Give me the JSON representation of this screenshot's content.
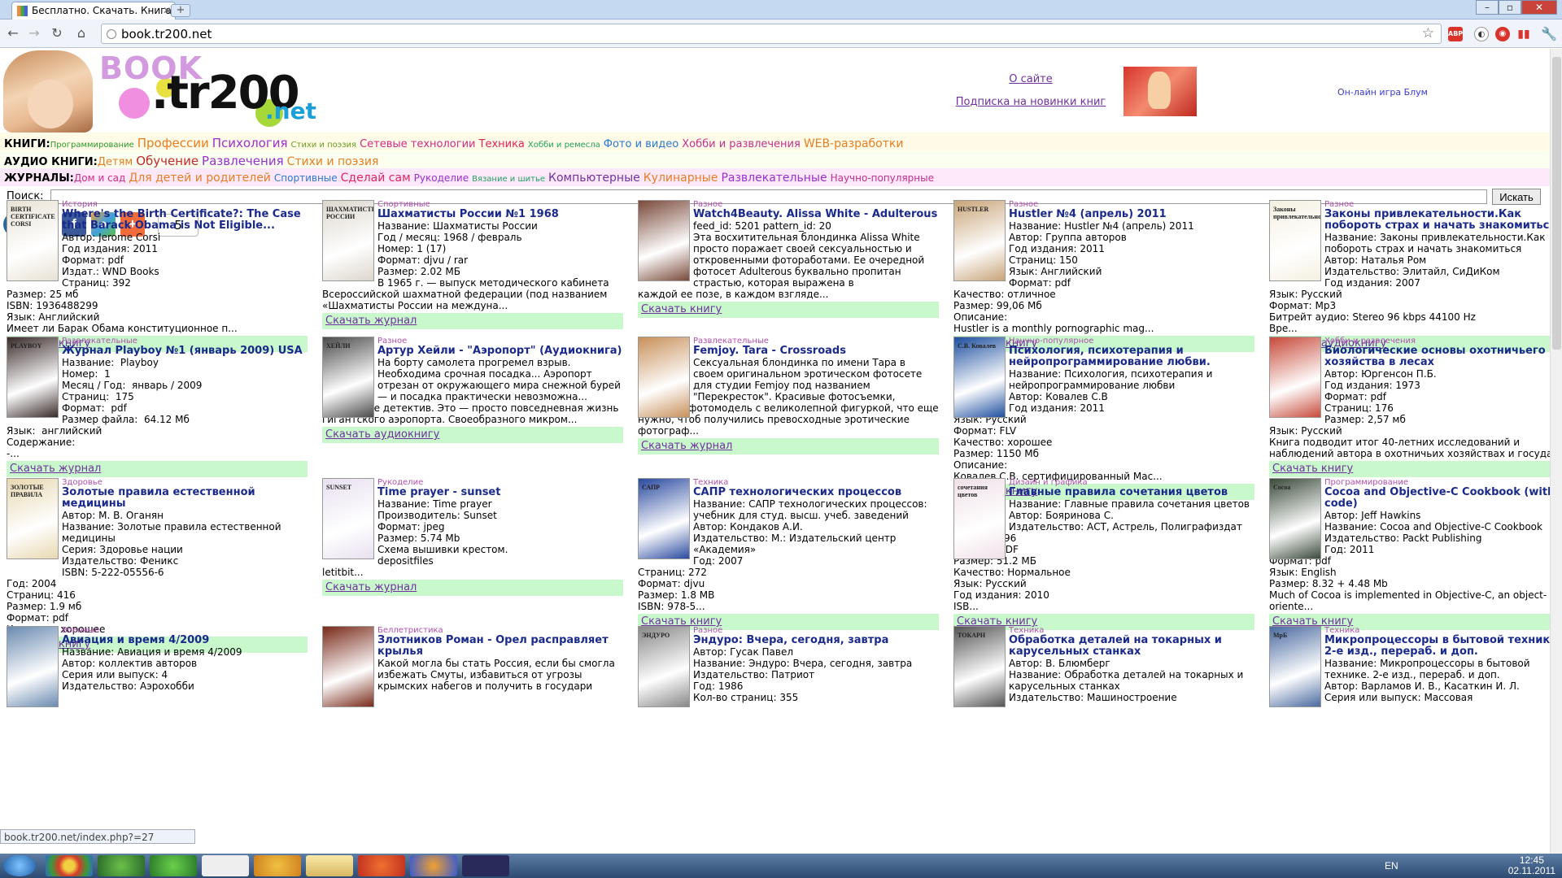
{
  "browser": {
    "tab_title": "Бесплатно. Скачать. Книга",
    "url": "book.tr200.net",
    "status_url": "book.tr200.net/index.php?=27"
  },
  "header": {
    "logo_book": "BOOK",
    "logo_tr": ".tr200",
    "logo_net": ".net",
    "about": "О сайте",
    "subscribe": "Подписка на новинки книг",
    "game": "Он-лайн игра Блум"
  },
  "cat_rows": [
    {
      "label": "КНИГИ:",
      "items": [
        {
          "text": "Программирование",
          "color": "#2a9a2a",
          "size": 10
        },
        {
          "text": "Профессии",
          "color": "#e67e22",
          "size": 15
        },
        {
          "text": "Психология",
          "color": "#9b30d0",
          "size": 15
        },
        {
          "text": "Стихи и поэзия",
          "color": "#6aa020",
          "size": 10
        },
        {
          "text": "Сетевые технологии",
          "color": "#d02b8a",
          "size": 13
        },
        {
          "text": "Техника",
          "color": "#e0245e",
          "size": 13
        },
        {
          "text": "Хобби и ремесла",
          "color": "#20a060",
          "size": 10
        },
        {
          "text": "Фото и видео",
          "color": "#2a7ad0",
          "size": 13
        },
        {
          "text": "Хобби и развлечения",
          "color": "#c03090",
          "size": 13
        },
        {
          "text": "WEB-разработки",
          "color": "#e67e22",
          "size": 14
        }
      ]
    },
    {
      "label": "АУДИО КНИГИ:",
      "items": [
        {
          "text": "Детям",
          "color": "#e67e22",
          "size": 13
        },
        {
          "text": "Обучение",
          "color": "#c02a2a",
          "size": 15
        },
        {
          "text": "Развлечения",
          "color": "#9b30d0",
          "size": 15
        },
        {
          "text": "Стихи и поэзия",
          "color": "#e67e22",
          "size": 14
        }
      ]
    },
    {
      "label": "ЖУРНАЛЫ:",
      "items": [
        {
          "text": "Дом и сад",
          "color": "#d02b8a",
          "size": 12
        },
        {
          "text": "Для детей и родителей",
          "color": "#e67e22",
          "size": 14
        },
        {
          "text": "Спортивные",
          "color": "#2a7ad0",
          "size": 12
        },
        {
          "text": "Сделай сам",
          "color": "#e0245e",
          "size": 14
        },
        {
          "text": "Рукоделие",
          "color": "#9b30d0",
          "size": 12
        },
        {
          "text": "Вязание и шитье",
          "color": "#20a060",
          "size": 10
        },
        {
          "text": "Компьютерные",
          "color": "#7030a0",
          "size": 14
        },
        {
          "text": "Кулинарные",
          "color": "#e67e22",
          "size": 14
        },
        {
          "text": "Развлекательные",
          "color": "#9b30d0",
          "size": 14
        },
        {
          "text": "Научно-популярные",
          "color": "#c03090",
          "size": 12
        }
      ]
    }
  ],
  "search": {
    "label": "Поиск:",
    "button": "Искать"
  },
  "social_count": "5",
  "cards": [
    {
      "cat": "История",
      "title": "Where's the Birth Certificate?: The Case that Barack Obama is Not Eligible...",
      "side": "Автор: Jerome Corsi\nГод издания: 2011\nФормат: pdf\nИздат.: WND Books\nСтраниц: 392",
      "rest": "Размер: 25 мб\nISBN: 1936488299\nЯзык: Английский\nИмеет ли Барак Обама конституционное п...",
      "link": "Скачать книгу",
      "thumb": "BIRTH CERTIFICATE CORSI",
      "tc": "#e8e2d4"
    },
    {
      "cat": "Спортивные",
      "title": "Шахматисты России №1 1968",
      "side": "Название: Шахматисты России\nГод / месяц: 1968 / февраль\nНомер: 1 (17)\nФормат: djvu / rar\nРазмер: 2.02 МБ\nВ 1965 г. — выпуск методического кабинета",
      "rest": "Всероссийской шахматной федерации (под названием «Шахматисты России на междуна...",
      "link": "Скачать журнал",
      "thumb": "ШАХМАТИСТЫ РОССИИ",
      "tc": "#dcd6cc"
    },
    {
      "cat": "Разное",
      "title": "Watch4Beauty. Alissa White - Adulterous",
      "side": "feed_id: 5201 pattern_id: 20\nЭта восхитительная блондинка Alissa White просто поражает своей сексуальностью и откровенными фотоработами. Ее очередной фотосет Adulterous буквально пропитан страстью, которая выражена в",
      "rest": "каждой ее позе, в каждом взгляде...",
      "link": "Скачать книгу",
      "thumb": "",
      "tc": "#7a4a3a"
    },
    {
      "cat": "Разное",
      "title": "Hustler №4 (апрель) 2011",
      "side": "Название: Hustler №4 (апрель) 2011\nАвтор: Группа авторов\nГод издания: 2011\nСтраниц: 150\nЯзык: Английский\nФормат: pdf",
      "rest": "Качество: отличное\nРазмер: 99,06 Мб\nОписание:\nHustler is a monthly pornographic mag...",
      "link": "Скачать книгу",
      "thumb": "HUSTLER",
      "tc": "#c8a478"
    },
    {
      "cat": "Разное",
      "title": "Законы привлекательности.Как побороть страх и начать знакомиться.",
      "side": "Название: Законы привлекательности.Как побороть страх и начать знакомиться\nАвтор: Наталья Ром\nИздательство: Элитайл, СиДиКом\nГод издания: 2007",
      "rest": "Язык: Русский\nФормат: Mp3\nБитрейт аудио: Stereo 96 kbps 44100 Hz\nВре...",
      "link": "Скачать аудиокнигу",
      "thumb": "Законы привлекательности",
      "tc": "#f4f0e0"
    },
    {
      "cat": "Развлекательные",
      "title": "Журнал Playboy №1 (январь 2009) USA",
      "side": "Название:  Playboy\nНомер:  1\nМесяц / Год:  январь / 2009\nСтраниц:  175\nФормат:  pdf\nРазмер файла:  64.12 Мб",
      "rest": "Язык:  английский\nСодержание:\n-...",
      "link": "Скачать журнал",
      "thumb": "PLAYBOY",
      "tc": "#3a2a2a"
    },
    {
      "cat": "Разное",
      "title": "Артур Хейли - \"Аэропорт\" (Аудиокнига)",
      "side": "На борту самолета прогремел взрыв. Необходима срочная посадка... Аэропорт отрезан от окружающего мира снежной бурей — и посадка практически невозможна...",
      "rest": "Нет, это не детектив. Это — просто повседневная жизнь гигантского аэропорта. Своеобразного микром...",
      "link": "Скачать аудиокнигу",
      "thumb": "ХЕЙЛИ",
      "tc": "#4a4a4a"
    },
    {
      "cat": "Развлекательные",
      "title": "Femjoy. Tara - Crossroads",
      "side": "Сексуальная блондинка по имени Тара в своем оригинальном эротическом фотосете для студии Femjoy под названием \"Перекресток\". Красивые фотосъемки,",
      "rest": "красивая фотомодель с великолепной фигуркой, что еще нужно, чтоб получились превосходные эротические фотограф...",
      "link": "Скачать журнал",
      "thumb": "",
      "tc": "#c8905a"
    },
    {
      "cat": "Научно-популярное",
      "title": "Психология, психотерапия и нейропрограммирование любви.",
      "side": "Название: Психология, психотерапия и нейропрограммирование любви\nАвтор: Ковалев С.В\nГод издания: 2011",
      "rest": "Язык: Русский\nФормат: FLV\nКачество: хорошее\nРазмер: 1150 Мб\nОписание:\nКовалев С.В. сертифицированный Мас...",
      "link": "Скачать книгу",
      "thumb": "С.В. Ковалев",
      "tc": "#1d4fa0"
    },
    {
      "cat": "Хобби и развлечения",
      "title": "Биологические основы охотничьего хозяйства в лесах",
      "side": "Автор: Юргенсон П.Б.\nГод издания: 1973\nФормат: pdf\nСтраниц: 176\nРазмер: 2,57 мб",
      "rest": "Язык: Русский\nКнига подводит итог 40-летних исследований и наблюдений автора в охотничьих хозяйствах и госуда...",
      "link": "Скачать книгу",
      "thumb": "",
      "tc": "#c84a3a"
    },
    {
      "cat": "Здоровье",
      "title": "Золотые правила естественной медицины",
      "side": "Автор: М. В. Оганян\nНазвание: Золотые правила естественной медицины\nСерия: Здоровье нации\nИздательство: Феникс\nISBN: 5-222-05556-6",
      "rest": "Год: 2004\nСтраниц: 416\nРазмер: 1.9 мб\nФормат: pdf\nКачество: хорошее",
      "link": "Скачать книгу",
      "thumb": "ЗОЛОТЫЕ ПРАВИЛА",
      "tc": "#e8d8b0"
    },
    {
      "cat": "Рукоделие",
      "title": "Time prayer - sunset",
      "side": "Название: Time prayer\nПроизводитель: Sunset\nФормат: jpeg\nРазмер: 5.74 Mb\nСхема вышивки крестом.\ndepositfiles",
      "rest": "letitbit...",
      "link": "Скачать журнал",
      "thumb": "SUNSET",
      "tc": "#e8e0f0"
    },
    {
      "cat": "Техника",
      "title": "САПР технологических процессов",
      "side": "Название: САПР технологических процессов: учебник для студ. высш. учеб. заведений\nАвтор: Кондаков А.И.\nИздательство: М.: Издательский центр «Академия»\nГод: 2007",
      "rest": "Страниц: 272\nФормат: djvu\nРазмер: 1.8 MB\nISBN: 978-5...",
      "link": "Скачать книгу",
      "thumb": "САПР",
      "tc": "#2a4aa0"
    },
    {
      "cat": "Дизайн и графика",
      "title": "Главные правила сочетания цветов",
      "side": "Название: Главные правила сочетания цветов\nАвтор: Бояринова С.\nИздательство: АСТ, Астрель, Полиграфиздат",
      "rest": "Страниц: 96\nФормат: PDF\nРазмер: 51.2 МБ\nКачество: Нормальное\nЯзык: Русский\nГод издания: 2010\nISB...",
      "link": "Скачать книгу",
      "thumb": "сочетания цветов",
      "tc": "#f0e0e8"
    },
    {
      "cat": "Программирование",
      "title": "Cocoa and Objective-C Cookbook (with code)",
      "side": "Автор: Jeff Hawkins\nНазвание: Cocoa and Objective-C Cookbook\nИздательство: Packt Publishing\nГод: 2011",
      "rest": "Формат: pdf\nЯзык: English\nРазмер: 8.32 + 4.48 Mb\nMuch of Cocoa is implemented in Objective-C, an object-oriente...",
      "link": "Скачать книгу",
      "thumb": "Cocoa",
      "tc": "#3a4a3a"
    },
    {
      "cat": "Военные",
      "title": "Авиация и время 4/2009",
      "side": "Название: Авиация и время 4/2009\nАвтор: коллектив авторов\nСерия или выпуск: 4\nИздательство: Аэрохобби",
      "rest": "",
      "link": "",
      "thumb": "",
      "tc": "#6a8ab0"
    },
    {
      "cat": "Беллетристика",
      "title": "Злотников Роман - Орел расправляет крылья",
      "side": "Какой могла бы стать Россия, если бы смогла избежать Смуты, избавиться от угрозы крымских набегов и получить в государи",
      "rest": "",
      "link": "",
      "thumb": "",
      "tc": "#7a2a1a"
    },
    {
      "cat": "Разное",
      "title": "Эндуро: Вчера, сегодня, завтра",
      "side": "Автор: Гусак Павел\nНазвание: Эндуро: Вчера, сегодня, завтра\nИздательство: Патриот\nГод: 1986\nКол-во страниц: 355",
      "rest": "",
      "link": "",
      "thumb": "ЭНДУРО",
      "tc": "#888"
    },
    {
      "cat": "Техника",
      "title": "Обработка деталей на токарных и карусельных станках",
      "side": "Автор: В. Блюмберг\nНазвание: Обработка деталей на токарных и карусельных станках\nИздательство: Машиностроение",
      "rest": "",
      "link": "",
      "thumb": "ТОКАРН",
      "tc": "#555"
    },
    {
      "cat": "Техника",
      "title": "Микропроцессоры в бытовой технике. 2-е изд., перераб. и доп.",
      "side": "Название: Микропроцессоры в бытовой технике. 2-е изд., перераб. и доп.\nАвтор: Варламов И. В., Касаткин И. Л.\nСерия или выпуск: Массовая",
      "rest": "",
      "link": "",
      "thumb": "МрБ",
      "tc": "#4a6aa0"
    }
  ],
  "taskbar": {
    "lang": "EN",
    "time": "12:45",
    "date": "02.11.2011"
  }
}
